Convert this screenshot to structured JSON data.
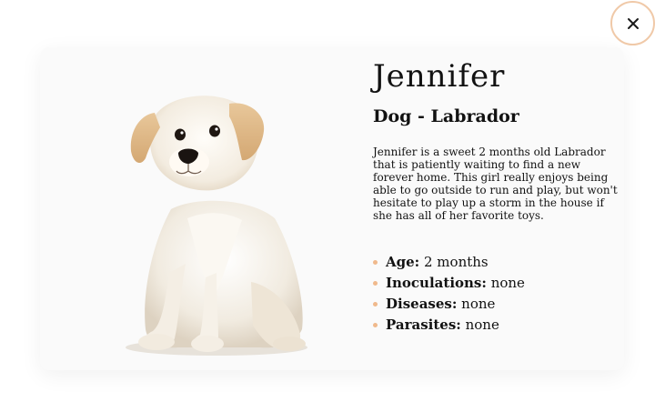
{
  "pet": {
    "name": "Jennifer",
    "breed": "Dog - Labrador",
    "description": "Jennifer is a sweet 2 months old Labrador that is patiently waiting to find a new forever home. This girl really enjoys being able to go outside to run and play, but won't hesitate to play up a storm in the house if she has all of her favorite toys.",
    "photo_alt": "Cream labrador puppy sitting",
    "facts": [
      {
        "label": "Age:",
        "value": "2 months"
      },
      {
        "label": "Inoculations:",
        "value": "none"
      },
      {
        "label": "Diseases:",
        "value": "none"
      },
      {
        "label": "Parasites:",
        "value": "none"
      }
    ]
  },
  "close_button": {
    "icon": "close-icon"
  },
  "colors": {
    "accent": "#f0b98c",
    "close_border": "#f0c9a8",
    "card_background": "#fafafa",
    "text": "#121212"
  }
}
